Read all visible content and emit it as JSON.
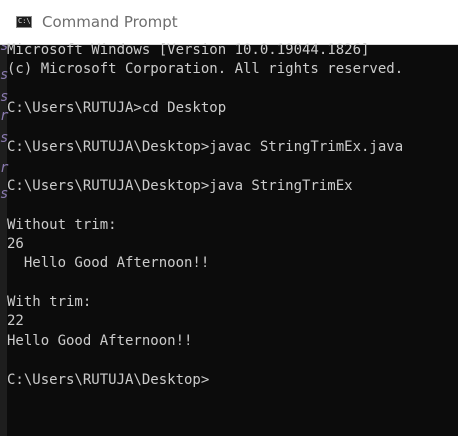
{
  "window": {
    "title": "Command Prompt",
    "icon_text": "C:\\",
    "icon": "cmd-window-icon"
  },
  "console": {
    "lines": [
      "Microsoft Windows [Version 10.0.19044.1826]",
      "(c) Microsoft Corporation. All rights reserved.",
      "",
      "C:\\Users\\RUTUJA>cd Desktop",
      "",
      "C:\\Users\\RUTUJA\\Desktop>javac StringTrimEx.java",
      "",
      "C:\\Users\\RUTUJA\\Desktop>java StringTrimEx",
      "",
      "Without trim:",
      "26",
      "  Hello Good Afternoon!!",
      "",
      "With trim:",
      "22",
      "Hello Good Afternoon!!",
      "",
      "C:\\Users\\RUTUJA\\Desktop>"
    ]
  },
  "colors": {
    "console_background": "#0c0c0c",
    "console_text": "#cccccc",
    "titlebar_background": "#ffffff",
    "titlebar_text": "#6e6e6e"
  }
}
